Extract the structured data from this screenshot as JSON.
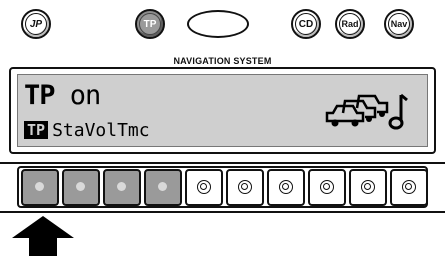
{
  "top_buttons": {
    "jp_label": "JP",
    "tp_label": "TP",
    "cd_label": "CD",
    "rad_label": "Rad",
    "nav_label": "Nav",
    "active": "TP"
  },
  "brand_label": "NAVIGATION SYSTEM",
  "display": {
    "line1_main": "TP",
    "line1_state": " on",
    "line2_indicator": "TP",
    "line2_menu": "StaVolTmc",
    "icon": "traffic-cars-music-note-icon"
  },
  "preset_keys": {
    "count": 10,
    "lit_count": 4,
    "lit_color": "#9a9a9a"
  },
  "indicator_arrow": "pointing-up-arrow-icon"
}
